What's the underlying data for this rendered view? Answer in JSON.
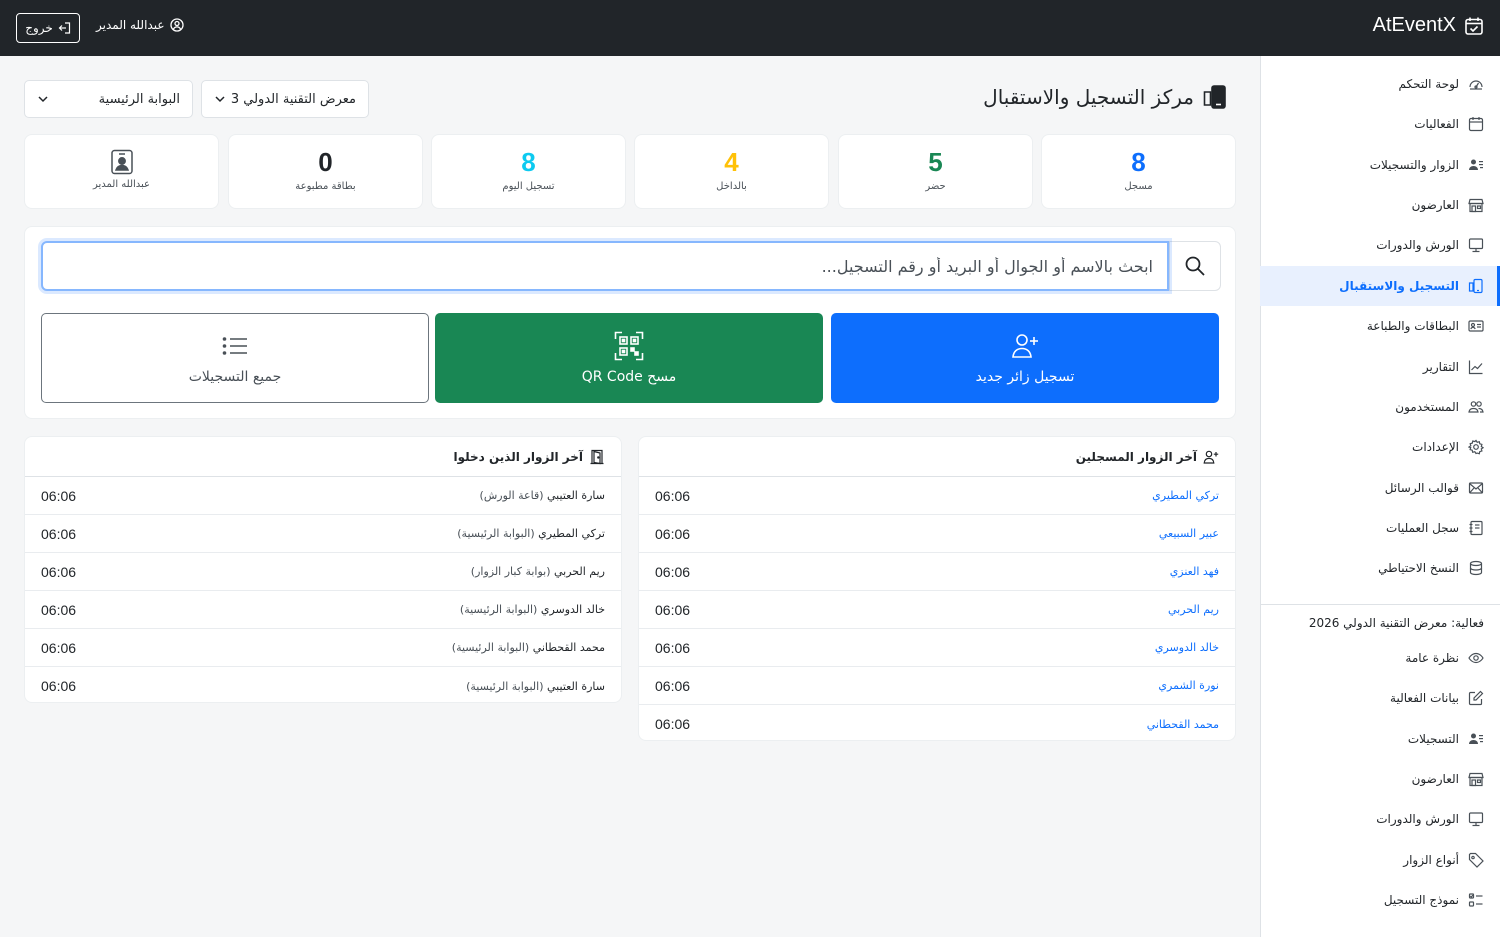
{
  "header": {
    "brand": "AtEventX",
    "user_name": "عبدالله المدير",
    "logout_label": "خروج"
  },
  "sidebar": {
    "items": [
      {
        "label": "لوحة التحكم",
        "icon": "speedometer-icon"
      },
      {
        "label": "الفعاليات",
        "icon": "calendar-icon"
      },
      {
        "label": "الزوار والتسجيلات",
        "icon": "person-lines-icon"
      },
      {
        "label": "العارضون",
        "icon": "shop-icon"
      },
      {
        "label": "الورش والدورات",
        "icon": "easel-icon"
      },
      {
        "label": "التسجيل والاستقبال",
        "icon": "phone-landscape-icon",
        "active": true
      },
      {
        "label": "البطاقات والطباعة",
        "icon": "id-card-icon"
      },
      {
        "label": "التقارير",
        "icon": "graph-up-icon"
      },
      {
        "label": "المستخدمون",
        "icon": "people-icon"
      },
      {
        "label": "الإعدادات",
        "icon": "gear-icon"
      },
      {
        "label": "قوالب الرسائل",
        "icon": "envelope-icon"
      },
      {
        "label": "سجل العمليات",
        "icon": "journal-icon"
      },
      {
        "label": "النسخ الاحتياطي",
        "icon": "database-icon"
      }
    ],
    "event_label": "فعالية: معرض التقنية الدولي 2026",
    "event_items": [
      {
        "label": "نظرة عامة",
        "icon": "eye-icon"
      },
      {
        "label": "بيانات الفعالية",
        "icon": "pencil-square-icon"
      },
      {
        "label": "التسجيلات",
        "icon": "person-lines-icon"
      },
      {
        "label": "العارضون",
        "icon": "shop-icon"
      },
      {
        "label": "الورش والدورات",
        "icon": "easel-icon"
      },
      {
        "label": "أنواع الزوار",
        "icon": "tag-icon"
      },
      {
        "label": "نموذج التسجيل",
        "icon": "ui-checks-icon"
      }
    ]
  },
  "main": {
    "title": "مركز التسجيل والاستقبال",
    "event_select": "معرض التقنية الدولي 3",
    "gate_select": "البوابة الرئيسية"
  },
  "stats": [
    {
      "value": "8",
      "label": "مسجل",
      "color": "#0d6efd"
    },
    {
      "value": "5",
      "label": "حضر",
      "color": "#198754"
    },
    {
      "value": "4",
      "label": "بالداخل",
      "color": "#ffc107"
    },
    {
      "value": "8",
      "label": "تسجيل اليوم",
      "color": "#0dcaf0"
    },
    {
      "value": "0",
      "label": "بطاقة مطبوعة",
      "color": "#212529"
    },
    {
      "label": "عبدالله المدير",
      "icon": "person-badge-icon"
    }
  ],
  "search": {
    "placeholder": "ابحث بالاسم أو الجوال أو البريد أو رقم التسجيل..."
  },
  "actions": {
    "new_visitor": "تسجيل زائر جديد",
    "scan_qr": "مسح QR Code",
    "all_registrations": "جميع التسجيلات"
  },
  "recent_registered": {
    "title": "آخر الزوار المسجلين",
    "rows": [
      {
        "name": "تركي المطيري",
        "time": "06:06"
      },
      {
        "name": "عبير السبيعي",
        "time": "06:06"
      },
      {
        "name": "فهد العنزي",
        "time": "06:06"
      },
      {
        "name": "ريم الحربي",
        "time": "06:06"
      },
      {
        "name": "خالد الدوسري",
        "time": "06:06"
      },
      {
        "name": "نورة الشمري",
        "time": "06:06"
      },
      {
        "name": "محمد القحطاني",
        "time": "06:06"
      }
    ]
  },
  "recent_checked_in": {
    "title": "آخر الزوار الذين دخلوا",
    "rows": [
      {
        "name": "سارة العتيبي",
        "location": "(قاعة الورش)",
        "time": "06:06"
      },
      {
        "name": "تركي المطيري",
        "location": "(البوابة الرئيسية)",
        "time": "06:06"
      },
      {
        "name": "ريم الحربي",
        "location": "(بوابة كبار الزوار)",
        "time": "06:06"
      },
      {
        "name": "خالد الدوسري",
        "location": "(البوابة الرئيسية)",
        "time": "06:06"
      },
      {
        "name": "محمد القحطاني",
        "location": "(البوابة الرئيسية)",
        "time": "06:06"
      },
      {
        "name": "سارة العتيبي",
        "location": "(البوابة الرئيسية)",
        "time": "06:06"
      }
    ]
  }
}
